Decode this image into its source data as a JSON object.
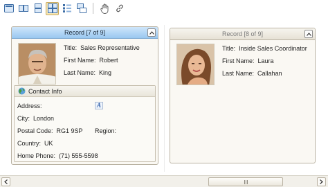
{
  "toolbar": {
    "buttons": [
      {
        "icon": "single-card-icon",
        "active": false
      },
      {
        "icon": "two-columns-icon",
        "active": false
      },
      {
        "icon": "two-rows-icon",
        "active": false
      },
      {
        "icon": "multi-column-icon",
        "active": true
      },
      {
        "icon": "customize-fields-icon",
        "active": false
      },
      {
        "icon": "show-layout-icon",
        "active": false
      },
      {
        "icon": "pan-hand-icon",
        "active": false
      },
      {
        "icon": "link-icon",
        "active": false
      }
    ]
  },
  "cards": [
    {
      "header": "Record [7 of 9]",
      "active": true,
      "title_label": "Title:",
      "title_value": "Sales Representative",
      "first_name_label": "First Name:",
      "first_name_value": "Robert",
      "last_name_label": "Last Name:",
      "last_name_value": "King",
      "contact": {
        "group_title": "Contact Info",
        "address_label": "Address:",
        "address_value": "",
        "city_label": "City:",
        "city_value": "London",
        "postal_label": "Postal Code:",
        "postal_value": "RG1 9SP",
        "region_label": "Region:",
        "region_value": "",
        "country_label": "Country:",
        "country_value": "UK",
        "phone_label": "Home Phone:",
        "phone_value": "(71) 555-5598"
      }
    },
    {
      "header": "Record [8 of 9]",
      "active": false,
      "title_label": "Title:",
      "title_value": "Inside Sales Coordinator",
      "first_name_label": "First Name:",
      "first_name_value": "Laura",
      "last_name_label": "Last Name:",
      "last_name_value": "Callahan"
    }
  ],
  "colors": {
    "active_header": "#99c7f0",
    "card_border": "#b9b2a2",
    "card_background": "#faf8f3"
  },
  "scrollbar": {
    "left_arrow_icon": "chevron-left-icon",
    "right_arrow_icon": "chevron-right-icon",
    "thumb_grip_icon": "grip-icon"
  }
}
